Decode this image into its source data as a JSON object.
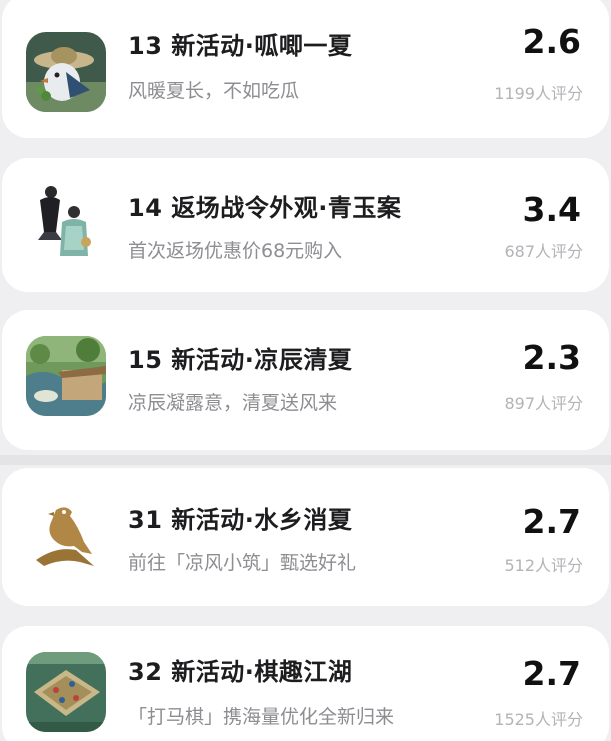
{
  "items": [
    {
      "title": "13 新活动·呱唧一夏",
      "subtitle": "风暖夏长，不如吃瓜",
      "score": "2.6",
      "count": "1199人评分",
      "icon": "bird-hat-icon"
    },
    {
      "title": "14 返场战令外观·青玉案",
      "subtitle": "首次返场优惠价68元购入",
      "score": "3.4",
      "count": "687人评分",
      "icon": "costume-characters-icon"
    },
    {
      "title": "15 新活动·凉辰清夏",
      "subtitle": "凉辰凝露意，清夏送风来",
      "score": "2.3",
      "count": "897人评分",
      "icon": "summer-scene-icon"
    },
    {
      "title": "31 新活动·水乡消夏",
      "subtitle": "前往「凉风小筑」甄选好礼",
      "score": "2.7",
      "count": "512人评分",
      "icon": "golden-bird-icon"
    },
    {
      "title": "32 新活动·棋趣江湖",
      "subtitle": "「打马棋」携海量优化全新归来",
      "score": "2.7",
      "count": "1525人评分",
      "icon": "chess-board-icon"
    }
  ]
}
